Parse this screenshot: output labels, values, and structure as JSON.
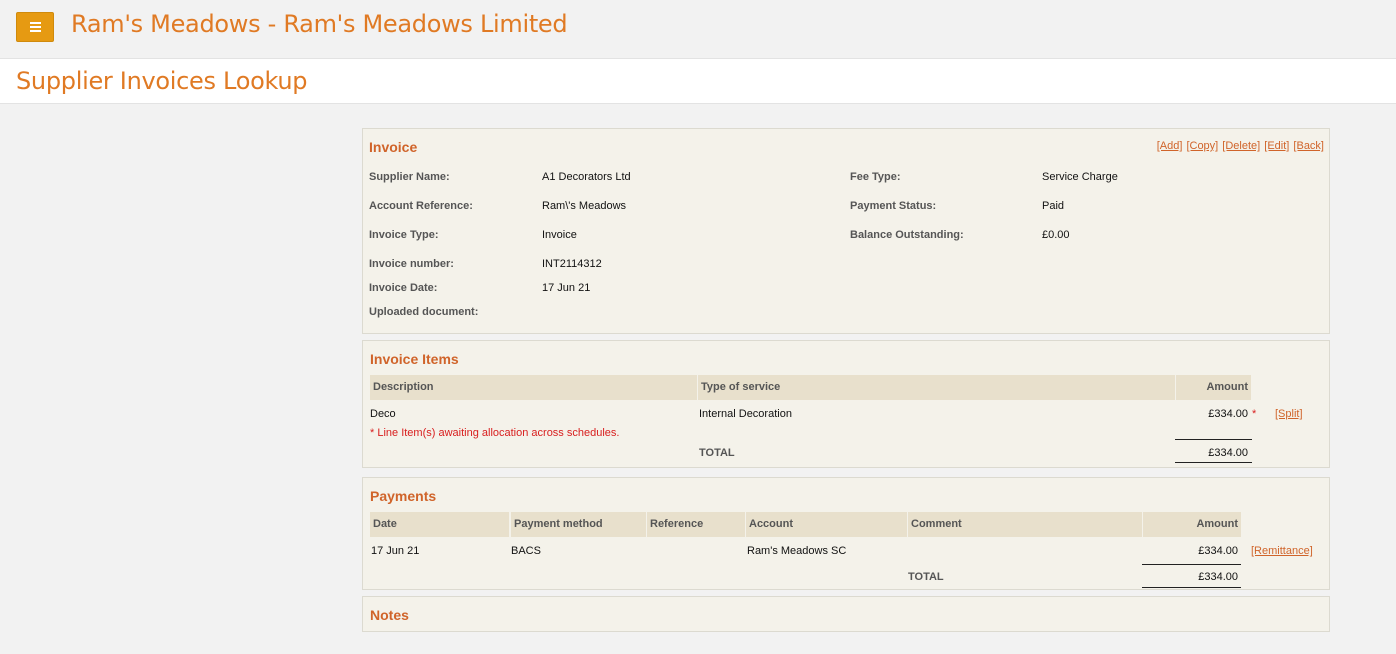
{
  "app": {
    "title": "Ram's Meadows - Ram's Meadows Limited"
  },
  "page": {
    "title": "Supplier Invoices Lookup"
  },
  "invoice": {
    "heading": "Invoice",
    "actions": [
      "[Add]",
      "[Copy]",
      "[Delete]",
      "[Edit]",
      "[Back]"
    ],
    "fields": {
      "supplier_name": {
        "label": "Supplier Name:",
        "value": "A1 Decorators Ltd"
      },
      "account_reference": {
        "label": "Account Reference:",
        "value": "Ram\\'s Meadows"
      },
      "invoice_type": {
        "label": "Invoice Type:",
        "value": "Invoice"
      },
      "invoice_number": {
        "label": "Invoice number:",
        "value": "INT2114312"
      },
      "invoice_date": {
        "label": "Invoice Date:",
        "value": "17 Jun 21"
      },
      "uploaded_document": {
        "label": "Uploaded document:",
        "value": ""
      },
      "fee_type": {
        "label": "Fee Type:",
        "value": "Service Charge"
      },
      "payment_status": {
        "label": "Payment Status:",
        "value": "Paid"
      },
      "balance_outstanding": {
        "label": "Balance Outstanding:",
        "value": "£0.00"
      }
    }
  },
  "items": {
    "heading": "Invoice Items",
    "columns": {
      "description": "Description",
      "type": "Type of service",
      "amount": "Amount"
    },
    "rows": [
      {
        "description": "Deco",
        "type": "Internal Decoration",
        "amount": "£334.00",
        "flag": "*",
        "action": "[Split]"
      }
    ],
    "note": "* Line Item(s) awaiting allocation across schedules.",
    "total_label": "TOTAL",
    "total": "£334.00"
  },
  "payments": {
    "heading": "Payments",
    "columns": {
      "date": "Date",
      "method": "Payment method",
      "reference": "Reference",
      "account": "Account",
      "comment": "Comment",
      "amount": "Amount"
    },
    "rows": [
      {
        "date": "17 Jun 21",
        "method": "BACS",
        "reference": "",
        "account": "Ram's Meadows SC",
        "comment": "",
        "amount": "£334.00",
        "action": "[Remittance]"
      }
    ],
    "total_label": "TOTAL",
    "total": "£334.00"
  },
  "notes": {
    "heading": "Notes"
  }
}
